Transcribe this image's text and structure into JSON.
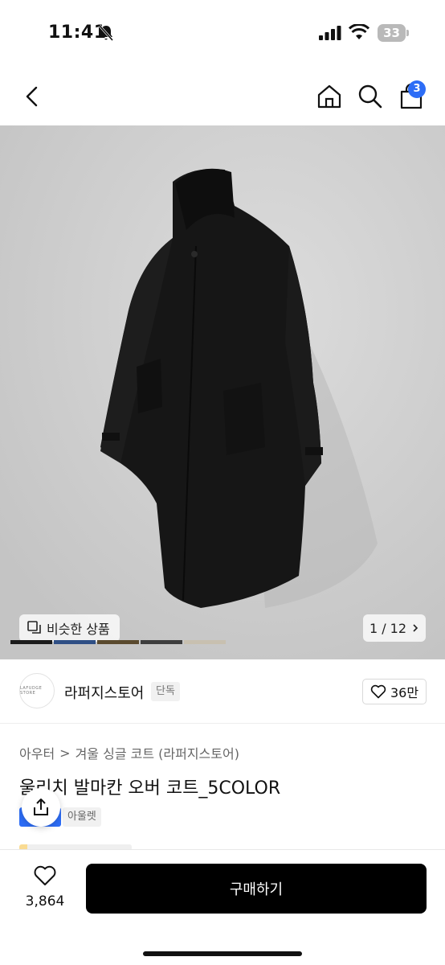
{
  "status": {
    "time": "11:41",
    "battery": "33"
  },
  "nav": {
    "cart_count": "3"
  },
  "image": {
    "similar_label": "비슷한 상품",
    "pager": "1 / 12",
    "swatch_colors": [
      "#1c1c1c",
      "#2f4f85",
      "#5a4a2e",
      "#3e3e3e",
      "#c8c0b0"
    ]
  },
  "store": {
    "logo_text": "LAFUDGE STORE",
    "name": "라퍼지스토어",
    "tag": "단독",
    "likes": "36만"
  },
  "product": {
    "category_1": "아우터",
    "category_sep": ">",
    "category_2": "겨울 싱글 코트 (라퍼지스토어)",
    "title": "울리치 발마칸 오버 코트_5COLOR",
    "brand_tag": "아울렛"
  },
  "bottom": {
    "wish_count": "3,864",
    "buy_label": "구매하기"
  },
  "colors": {
    "accent": "#2d6df6",
    "buy_button": "#000000"
  }
}
